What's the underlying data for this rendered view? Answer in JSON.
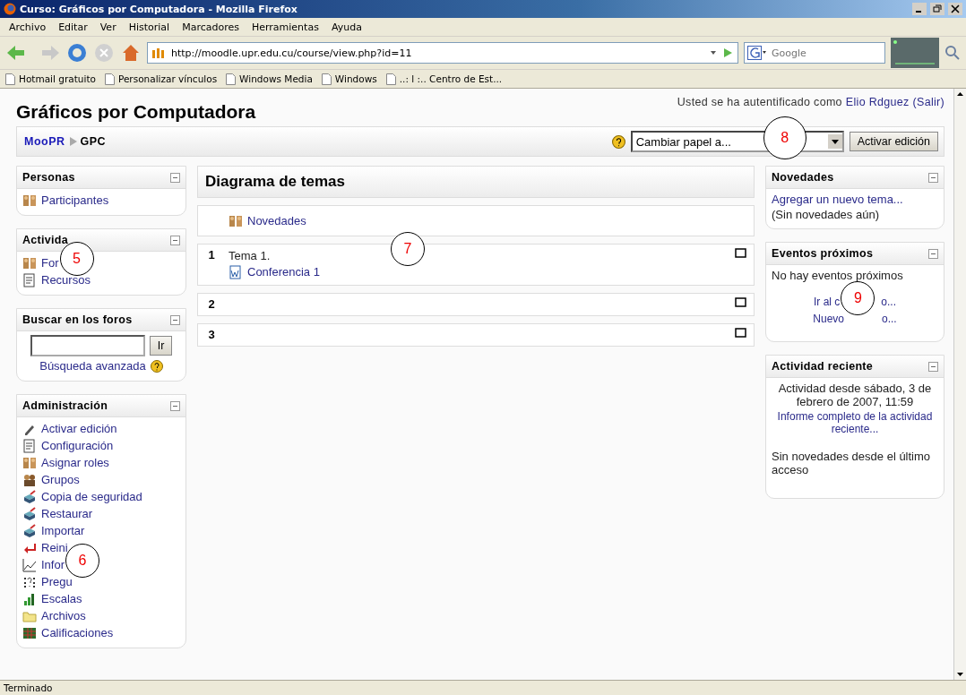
{
  "window": {
    "title": "Curso: Gráficos por Computadora - Mozilla Firefox"
  },
  "menu": [
    "Archivo",
    "Editar",
    "Ver",
    "Historial",
    "Marcadores",
    "Herramientas",
    "Ayuda"
  ],
  "address": {
    "value": "http://moodle.upr.edu.cu/course/view.php?id=11"
  },
  "search": {
    "placeholder": "Google"
  },
  "bookmarks": [
    "Hotmail gratuito",
    "Personalizar vínculos",
    "Windows Media",
    "Windows",
    "..: l :.. Centro de Est..."
  ],
  "page": {
    "title": "Gráficos por Computadora",
    "login_prefix": "Usted se ha autentificado como",
    "user": "Elio Rdguez",
    "logout": "(Salir)",
    "breadcrumb": [
      "MooPR",
      "GPC"
    ],
    "role_select": {
      "value": "Cambiar papel a...",
      "callout": "8"
    },
    "edit_button": "Activar edición"
  },
  "left_blocks": [
    {
      "kind": "list",
      "title": "Personas",
      "items": [
        {
          "label": "Participantes"
        }
      ]
    },
    {
      "kind": "list",
      "title": "Activida",
      "items": [
        {
          "label": "For",
          "callout": "5"
        },
        {
          "label": "Recursos"
        }
      ]
    },
    {
      "kind": "search",
      "title": "Buscar en los foros",
      "button": "Ir",
      "link": "Búsqueda avanzada"
    },
    {
      "kind": "list",
      "title": "Administración",
      "items": [
        {
          "label": "Activar edición"
        },
        {
          "label": "Configuración"
        },
        {
          "label": "Asignar roles"
        },
        {
          "label": "Grupos"
        },
        {
          "label": "Copia de seguridad"
        },
        {
          "label": "Restaurar"
        },
        {
          "label": "Importar"
        },
        {
          "label": "Reini"
        },
        {
          "label": "Infor",
          "callout": "6"
        },
        {
          "label": "Pregu"
        },
        {
          "label": "Escalas"
        },
        {
          "label": "Archivos"
        },
        {
          "label": "Calificaciones"
        }
      ]
    }
  ],
  "topics": {
    "title": "Diagrama de temas",
    "news": "Novedades",
    "sections": [
      {
        "number": "1",
        "summary": "Tema 1.",
        "items": [
          "Conferencia 1"
        ],
        "callout": "7"
      },
      {
        "number": "2"
      },
      {
        "number": "3"
      }
    ]
  },
  "right_blocks": [
    {
      "kind": "news",
      "title": "Novedades",
      "link": "Agregar un nuevo tema...",
      "text": "(Sin novedades aún)"
    },
    {
      "kind": "events",
      "title": "Eventos próximos",
      "text": "No hay eventos próximos",
      "links": [
        {
          "parts": [
            "Ir al c",
            "o..."
          ],
          "callout": "9"
        },
        {
          "parts": [
            "Nuevo",
            "o..."
          ]
        }
      ]
    },
    {
      "kind": "recent",
      "title": "Actividad reciente",
      "text": "Actividad desde sábado, 3 de febrero de 2007, 11:59",
      "link": "Informe completo de la actividad reciente...",
      "note": "Sin novedades desde el último acceso"
    }
  ],
  "status_bar": "Terminado"
}
